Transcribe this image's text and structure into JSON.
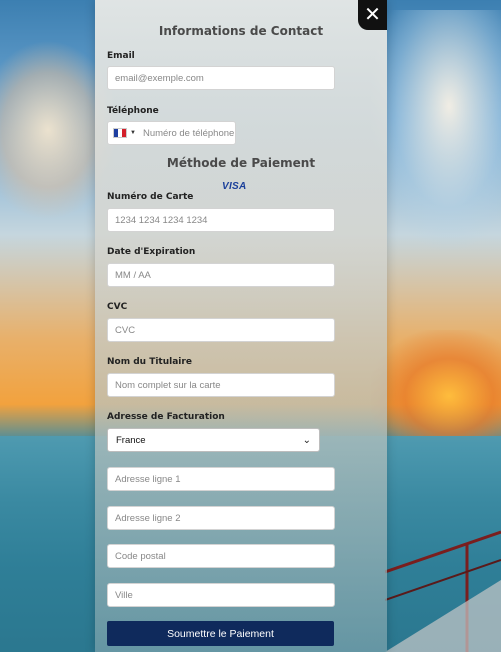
{
  "contact": {
    "title": "Informations de Contact",
    "email_label": "Email",
    "email_placeholder": "email@exemple.com",
    "phone_label": "Téléphone",
    "phone_placeholder": "Numéro de téléphone"
  },
  "payment": {
    "title": "Méthode de Paiement",
    "card_brand": "VISA",
    "card_number_label": "Numéro de Carte",
    "card_number_placeholder": "1234 1234 1234 1234",
    "expiry_label": "Date d'Expiration",
    "expiry_placeholder": "MM / AA",
    "cvc_label": "CVC",
    "cvc_placeholder": "CVC",
    "holder_label": "Nom du Titulaire",
    "holder_placeholder": "Nom complet sur la carte"
  },
  "billing": {
    "label": "Adresse de Facturation",
    "country_selected": "France",
    "address1_placeholder": "Adresse ligne 1",
    "address2_placeholder": "Adresse ligne 2",
    "postal_placeholder": "Code postal",
    "city_placeholder": "Ville"
  },
  "submit_label": "Soumettre le Paiement",
  "close_label": "✕",
  "colors": {
    "submit_bg": "#0f2a5c",
    "close_bg": "#111111",
    "visa_blue": "#1a3f9a"
  }
}
